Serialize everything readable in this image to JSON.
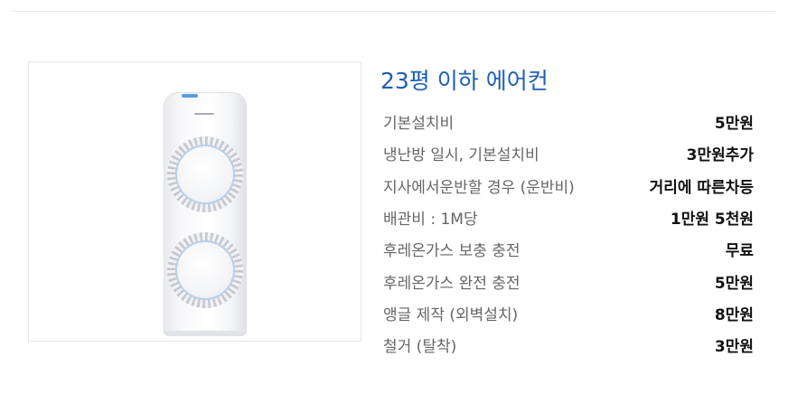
{
  "title": "23평 이하 에어컨",
  "product_icon": "standing-air-conditioner",
  "colors": {
    "title": "#1e5fb3",
    "label": "#666666",
    "value": "#111111"
  },
  "specs": [
    {
      "label": "기본설치비",
      "value": "5만원"
    },
    {
      "label": "냉난방 일시, 기본설치비",
      "value": "3만원추가"
    },
    {
      "label": "지사에서운반할 경우 (운반비)",
      "value": "거리에 따른차등"
    },
    {
      "label": "배관비 : 1M당",
      "value": "1만원 5천원"
    },
    {
      "label": "후레온가스 보충 충전",
      "value": "무료"
    },
    {
      "label": "후레온가스 완전 충전",
      "value": "5만원"
    },
    {
      "label": "앵글 제작 (외벽설치)",
      "value": "8만원"
    },
    {
      "label": "철거 (탈착)",
      "value": "3만원"
    }
  ]
}
